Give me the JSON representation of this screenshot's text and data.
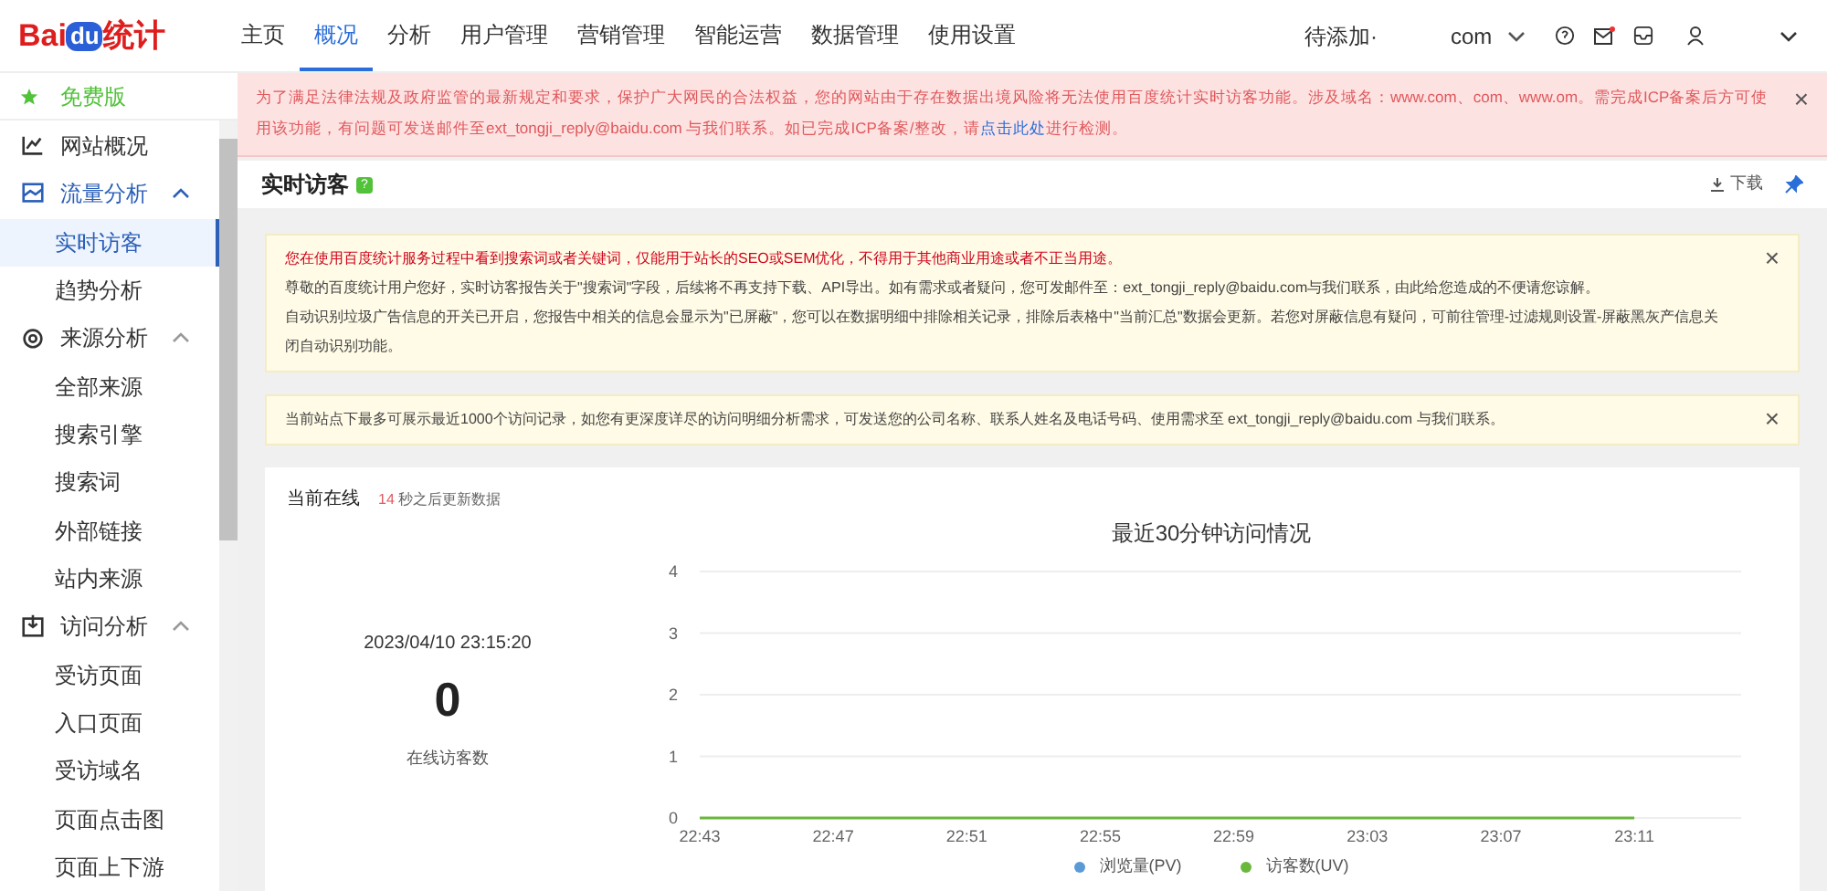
{
  "logo": {
    "text_a": "Bai",
    "text_b": "du",
    "text_c": "统计"
  },
  "nav": [
    {
      "label": "主页",
      "selected": false
    },
    {
      "label": "概况",
      "selected": true
    },
    {
      "label": "分析",
      "selected": false
    },
    {
      "label": "用户管理",
      "selected": false
    },
    {
      "label": "营销管理",
      "selected": false
    },
    {
      "label": "智能运营",
      "selected": false
    },
    {
      "label": "数据管理",
      "selected": false
    },
    {
      "label": "使用设置",
      "selected": false
    }
  ],
  "header_right": {
    "pending": "待添加·",
    "site": "com"
  },
  "sidebar": {
    "promo": "免费版",
    "items": [
      {
        "label": "网站概况",
        "kind": "link"
      },
      {
        "label": "流量分析",
        "kind": "group",
        "expanded": true,
        "active": true,
        "children": [
          {
            "label": "实时访客",
            "selected": true
          },
          {
            "label": "趋势分析",
            "selected": false
          }
        ]
      },
      {
        "label": "来源分析",
        "kind": "group",
        "expanded": true,
        "active": false,
        "children": [
          {
            "label": "全部来源",
            "selected": false
          },
          {
            "label": "搜索引擎",
            "selected": false
          },
          {
            "label": "搜索词",
            "selected": false
          },
          {
            "label": "外部链接",
            "selected": false
          },
          {
            "label": "站内来源",
            "selected": false
          }
        ]
      },
      {
        "label": "访问分析",
        "kind": "group",
        "expanded": true,
        "active": false,
        "children": [
          {
            "label": "受访页面",
            "selected": false
          },
          {
            "label": "入口页面",
            "selected": false
          },
          {
            "label": "受访域名",
            "selected": false
          },
          {
            "label": "页面点击图",
            "selected": false
          },
          {
            "label": "页面上下游",
            "selected": false
          }
        ]
      }
    ]
  },
  "alert": {
    "text_before": "为了满足法律法规及政府监管的最新规定和要求，保护广大网民的合法权益，您的网站由于存在数据出境风险将无法使用百度统计实时访客功能。涉及域名：www.com、com、www.om。需完成ICP备案后方可使用该功能，有问题可发送邮件至ext_tongji_reply@baidu.com 与我们联系。如已完成ICP备案/整改，请",
    "link": "点击此处",
    "text_after": "进行检测。",
    "close": "×"
  },
  "page_header": {
    "title": "实时访客",
    "badge": "?",
    "download": "下载"
  },
  "notices": [
    {
      "lines": [
        {
          "text": "您在使用百度统计服务过程中看到搜索词或者关键词，仅能用于站长的SEO或SEM优化，不得用于其他商业用途或者不正当用途。",
          "kind": "warning"
        },
        {
          "text": "尊敬的百度统计用户您好，实时访客报告关于\"搜索词\"字段，后续将不再支持下载、API导出。如有需求或者疑问，您可发邮件至：ext_tongji_reply@baidu.com与我们联系，由此给您造成的不便请您谅解。",
          "kind": "normal"
        },
        {
          "text": "自动识别垃圾广告信息的开关已开启，您报告中相关的信息会显示为\"已屏蔽\"，您可以在数据明细中排除相关记录，排除后表格中\"当前汇总\"数据会更新。若您对屏蔽信息有疑问，可前往管理-过滤规则设置-屏蔽黑灰产信息关闭自动识别功能。",
          "kind": "normal"
        }
      ],
      "close": "×"
    },
    {
      "lines": [
        {
          "text": "当前站点下最多可展示最近1000个访问记录，如您有更深度详尽的访问明细分析需求，可发送您的公司名称、联系人姓名及电话号码、使用需求至 ext_tongji_reply@baidu.com 与我们联系。",
          "kind": "normal"
        }
      ],
      "close": "×"
    }
  ],
  "online": {
    "title": "当前在线",
    "countdown": "14",
    "countdown_suffix": "秒之后更新数据",
    "datetime": "2023/04/10 23:15:20",
    "count": "0",
    "count_label": "在线访客数"
  },
  "chart_data": {
    "type": "line",
    "grid": true,
    "title": "最近30分钟访问情况",
    "x": [
      "22:43",
      "22:47",
      "22:51",
      "22:55",
      "22:59",
      "23:03",
      "23:07",
      "23:11"
    ],
    "ylim": [
      0,
      4
    ],
    "yticks": [
      0,
      1,
      2,
      3,
      4
    ],
    "series": [
      {
        "name": "浏览量(PV)",
        "color": "#5b9bd5",
        "values": [
          null,
          null,
          null,
          null,
          null,
          null,
          null,
          null
        ]
      },
      {
        "name": "访客数(UV)",
        "color": "#6ab73d",
        "values": [
          0,
          0,
          0,
          0,
          0,
          0,
          0,
          0
        ]
      }
    ]
  }
}
